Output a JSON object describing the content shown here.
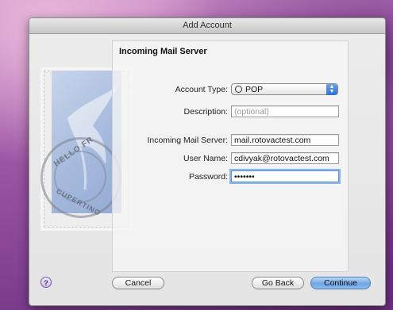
{
  "window": {
    "title": "Add Account"
  },
  "section": {
    "title": "Incoming Mail Server"
  },
  "stamp": {
    "postmark_top": "HELLO FR",
    "postmark_bottom": "CUPERTINO"
  },
  "form": {
    "account_type_label": "Account Type:",
    "account_type_value": "POP",
    "description_label": "Description:",
    "description_placeholder": "(optional)",
    "incoming_server_label": "Incoming Mail Server:",
    "incoming_server_value": "mail.rotovactest.com",
    "user_name_label": "User Name:",
    "user_name_value": "cdivyak@rotovactest.com",
    "password_label": "Password:",
    "password_value": "•••••••"
  },
  "buttons": {
    "help": "?",
    "cancel": "Cancel",
    "go_back": "Go Back",
    "continue": "Continue"
  },
  "colors": {
    "accent": "#6fa6e6",
    "focus_ring": "#8db6e8"
  }
}
